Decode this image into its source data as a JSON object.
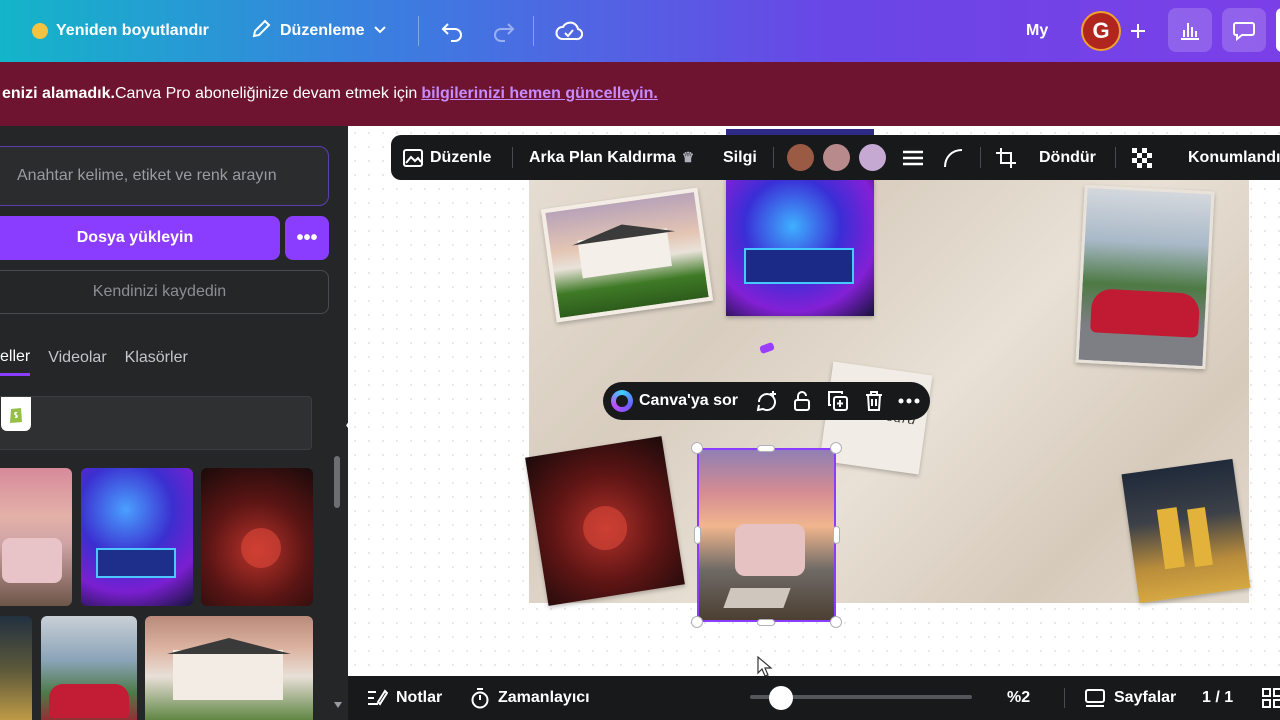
{
  "topbar": {
    "resize_label": "Yeniden boyutlandır",
    "edit_label": "Düzenleme",
    "my_label": "My",
    "avatar_initial": "G"
  },
  "banner": {
    "bold_text": "enizi alamadık.",
    "text": " Canva Pro aboneliğinize devam etmek için",
    "link_text": "bilgilerinizi hemen güncelleyin."
  },
  "sidebar": {
    "search_placeholder": "Anahtar kelime, etiket ve renk arayın",
    "upload_label": "Dosya yükleyin",
    "more_label": "•••",
    "record_label": "Kendinizi kaydedin",
    "tabs": [
      {
        "label": "eller",
        "active": true
      },
      {
        "label": "Videolar",
        "active": false
      },
      {
        "label": "Klasörler",
        "active": false
      }
    ],
    "collapse_label": "‹"
  },
  "image_toolbar": {
    "edit_label": "Düzenle",
    "bg_remove_label": "Arka Plan Kaldırma",
    "erase_label": "Silgi",
    "rotate_label": "Döndür",
    "position_label": "Konumlandır",
    "swatches": [
      "#9b5a44",
      "#b98a8c",
      "#c5a9d2"
    ]
  },
  "element_toolbar": {
    "ask_label": "Canva'ya sor"
  },
  "board": {
    "vision_text": "Vision Board"
  },
  "bottombar": {
    "notes_label": "Notlar",
    "timer_label": "Zamanlayıcı",
    "zoom_value": "%2",
    "pages_label": "Sayfalar",
    "page_count": "1 / 1"
  },
  "colors": {
    "accent": "#8b3dff",
    "banner_bg": "#6e1430",
    "panel_bg": "#252627",
    "toolbar_bg": "#18191b"
  }
}
